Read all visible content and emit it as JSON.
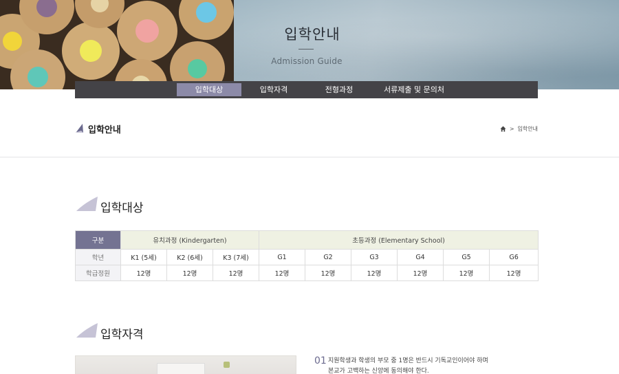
{
  "hero": {
    "title": "입학안내",
    "subtitle": "Admission Guide"
  },
  "nav": [
    {
      "label": "입학대상",
      "active": true
    },
    {
      "label": "입학자격",
      "active": false
    },
    {
      "label": "전형과정",
      "active": false
    },
    {
      "label": "서류제출 및 문의처",
      "active": false
    }
  ],
  "page": {
    "title": "입학안내"
  },
  "breadcrumb": {
    "home_icon": "home-icon",
    "separator": ">",
    "current": "입학안내"
  },
  "section1": {
    "title": "입학대상"
  },
  "table": {
    "corner": "구분",
    "group_kinder": "유치과정 (Kindergarten)",
    "group_elem": "초등과정 (Elementary School)",
    "row_grade_label": "학년",
    "row_quota_label": "학급정원",
    "grades": [
      "K1 (5세)",
      "K2 (6세)",
      "K3 (7세)",
      "G1",
      "G2",
      "G3",
      "G4",
      "G5",
      "G6"
    ],
    "quotas": [
      "12명",
      "12명",
      "12명",
      "12명",
      "12명",
      "12명",
      "12명",
      "12명",
      "12명"
    ]
  },
  "section2": {
    "title": "입학자격"
  },
  "qualification": {
    "number": "01",
    "line1": "지원학생과 학생의 부모 중 1명은 반드시 기독교인이어야 하며",
    "line2": "본교가 고백하는 신앙에 동의해야 한다."
  },
  "colors": {
    "nav_bg": "#444347",
    "nav_active": "#8c8aa8",
    "table_head": "#747392",
    "table_group": "#eff1e3",
    "accent": "#c6c3d6"
  }
}
